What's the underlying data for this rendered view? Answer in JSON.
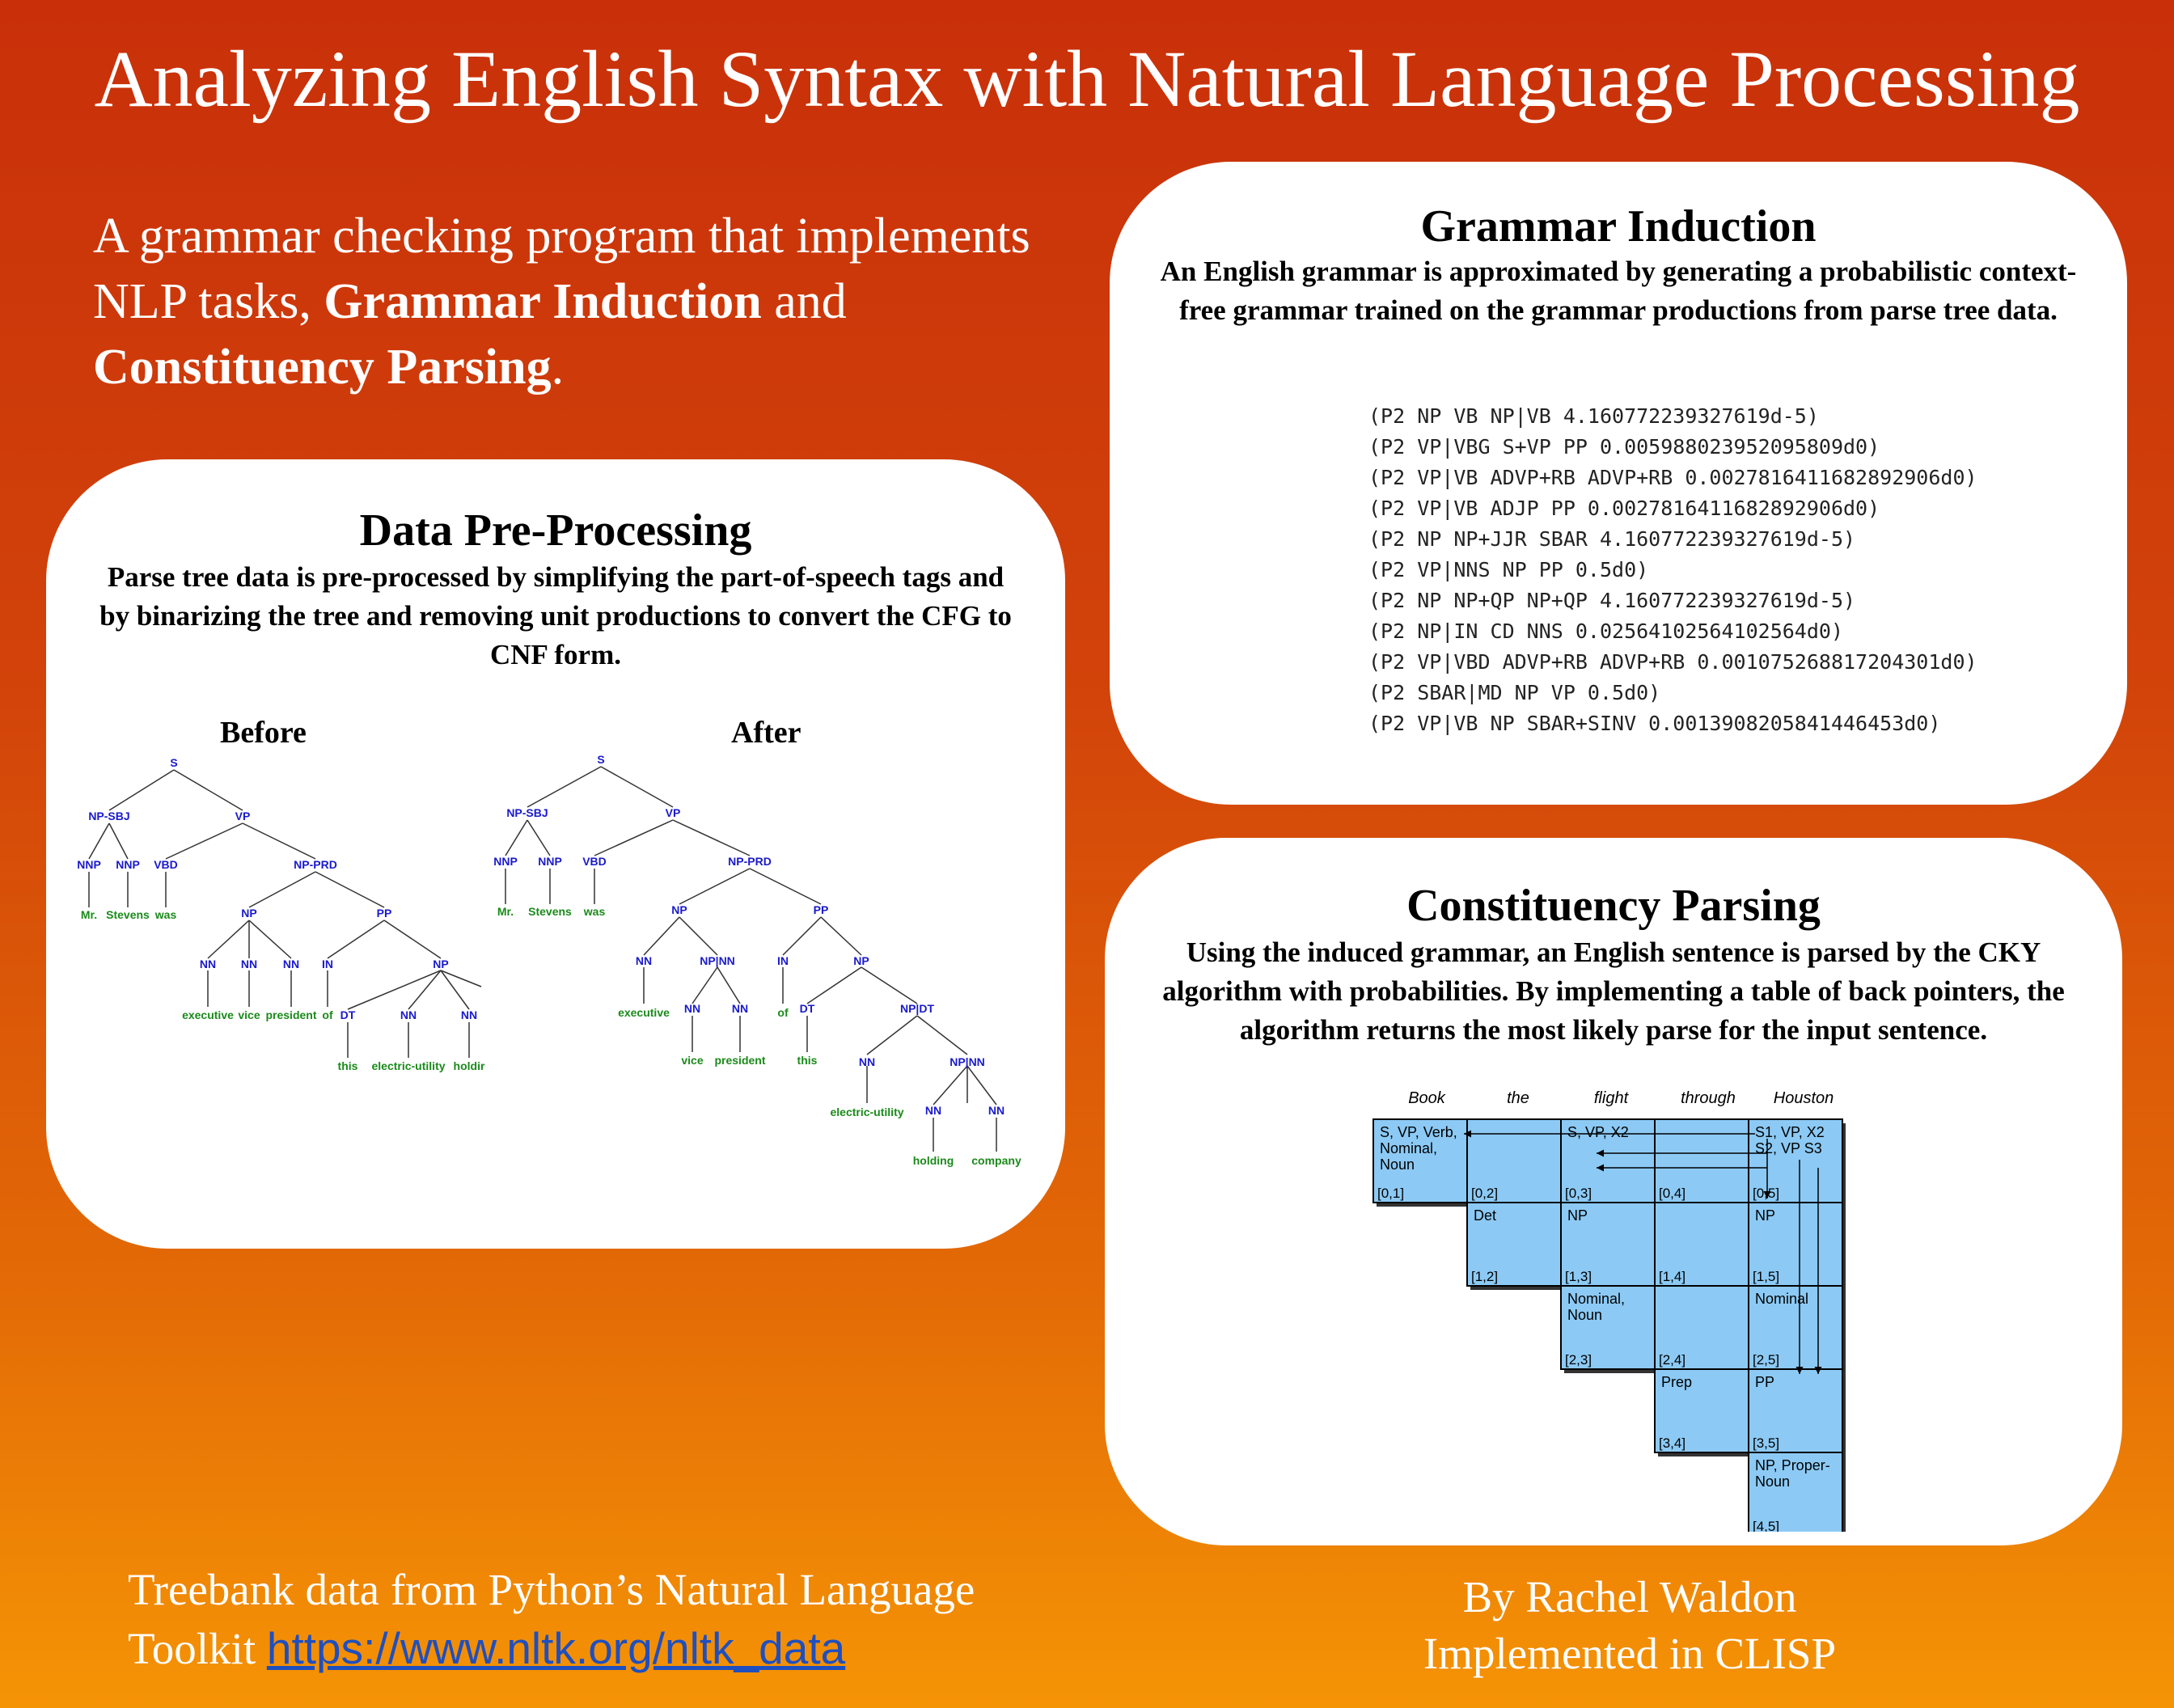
{
  "title": "Analyzing English Syntax with Natural Language Processing",
  "intro": {
    "part1": "A grammar checking program that implements NLP tasks, ",
    "bold1": "Grammar Induction",
    "part2": " and ",
    "bold2": "Constituency Parsing",
    "part3": "."
  },
  "preprocessing": {
    "title": "Data Pre-Processing",
    "description": "Parse tree data is pre-processed by simplifying the part-of-speech tags and by binarizing the tree and removing unit productions to convert the CFG to CNF form.",
    "before_label": "Before",
    "after_label": "After",
    "before_tree": {
      "nodes": [
        "S",
        "NP-SBJ",
        "VP",
        "NNP",
        "NNP",
        "VBD",
        "NP-PRD",
        "NP",
        "PP",
        "NN",
        "NN",
        "NN",
        "IN",
        "NP",
        "DT",
        "NN",
        "NN"
      ],
      "words": [
        "Mr.",
        "Stevens",
        "was",
        "executive",
        "vice",
        "president",
        "of",
        "this",
        "electric-utility",
        "holdir"
      ]
    },
    "after_tree": {
      "nodes": [
        "S",
        "NP-SBJ",
        "VP",
        "NNP",
        "NNP",
        "VBD",
        "NP-PRD",
        "NP",
        "PP",
        "NN",
        "NP|NN",
        "IN",
        "NP",
        "NN",
        "NN",
        "DT",
        "NP|DT",
        "NN",
        "NP|NN",
        "NN",
        "NN"
      ],
      "words": [
        "Mr.",
        "Stevens",
        "was",
        "executive",
        "vice",
        "president",
        "of",
        "this",
        "electric-utility",
        "holding",
        "company"
      ]
    }
  },
  "induction": {
    "title": "Grammar Induction",
    "description": "An English grammar is approximated by generating a probabilistic context-free grammar trained on the grammar productions from parse tree data.",
    "rules": [
      "(P2 NP VB NP|VB 4.160772239327619d-5)",
      "(P2 VP|VBG S+VP PP 0.005988023952095809d0)",
      "(P2 VP|VB ADVP+RB ADVP+RB 0.0027816411682892906d0)",
      "(P2 VP|VB ADJP PP 0.0027816411682892906d0)",
      "(P2 NP NP+JJR SBAR 4.160772239327619d-5)",
      "(P2 VP|NNS NP PP 0.5d0)",
      "(P2 NP NP+QP NP+QP 4.160772239327619d-5)",
      "(P2 NP|IN CD NNS 0.02564102564102564d0)",
      "(P2 VP|VBD ADVP+RB ADVP+RB 0.001075268817204301d0)",
      "(P2 SBAR|MD NP VP 0.5d0)",
      "(P2 VP|VB NP SBAR+SINV 0.0013908205841446453d0)"
    ]
  },
  "parsing": {
    "title": "Constituency Parsing",
    "description": "Using the induced grammar, an English sentence is parsed by the CKY algorithm with probabilities. By implementing a table of back pointers, the algorithm returns the most likely parse for the input sentence.",
    "headers": [
      "Book",
      "the",
      "flight",
      "through",
      "Houston"
    ],
    "cells": [
      {
        "label": "S, VP, Verb, Nominal, Noun",
        "span": "[0,1]"
      },
      {
        "label": "",
        "span": "[0,2]"
      },
      {
        "label": "S, VP, X2",
        "span": "[0,3]"
      },
      {
        "label": "",
        "span": "[0,4]"
      },
      {
        "label": "S1, VP, X2 S2, VP S3",
        "span": "[0,5]"
      },
      {
        "label": "Det",
        "span": "[1,2]"
      },
      {
        "label": "NP",
        "span": "[1,3]"
      },
      {
        "label": "",
        "span": "[1,4]"
      },
      {
        "label": "NP",
        "span": "[1,5]"
      },
      {
        "label": "Nominal, Noun",
        "span": "[2,3]"
      },
      {
        "label": "",
        "span": "[2,4]"
      },
      {
        "label": "Nominal",
        "span": "[2,5]"
      },
      {
        "label": "Prep",
        "span": "[3,4]"
      },
      {
        "label": "PP",
        "span": "[3,5]"
      },
      {
        "label": "NP, Proper- Noun",
        "span": "[4,5]"
      }
    ]
  },
  "footer": {
    "credit_text": "Treebank data from Python’s Natural Language",
    "credit_text2": "Toolkit ",
    "link": "https://www.nltk.org/nltk_data",
    "author": "By Rachel Waldon",
    "implementation": "Implemented in CLISP"
  },
  "colors": {
    "tree_node": "#1a1acc",
    "tree_word": "#1a8a1a",
    "cky_cell": "#8ccaf5"
  }
}
